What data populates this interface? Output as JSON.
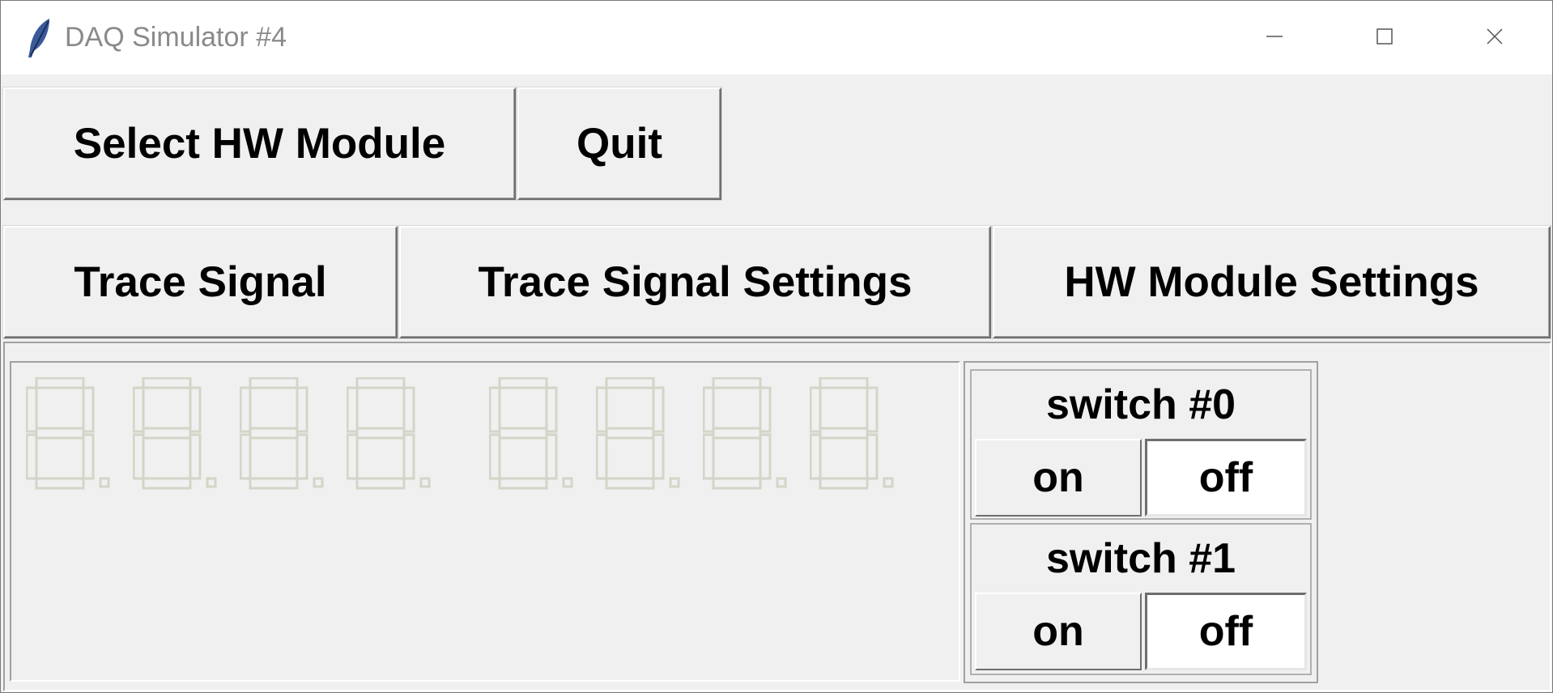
{
  "window": {
    "title": "DAQ Simulator #4",
    "icon": "feather-icon",
    "controls": [
      "minimize-icon",
      "maximize-icon",
      "close-icon"
    ]
  },
  "toolbar1": {
    "select_hw_module": "Select HW Module",
    "quit": "Quit"
  },
  "toolbar2": {
    "trace_signal": "Trace Signal",
    "trace_signal_settings": "Trace Signal Settings",
    "hw_module_settings": "HW Module Settings"
  },
  "display": {
    "digit_count": 8,
    "group_size": 4,
    "segment_color": "#d4d4c8",
    "lit_segments": []
  },
  "switches": [
    {
      "label": "switch #0",
      "on_label": "on",
      "off_label": "off",
      "state": "off"
    },
    {
      "label": "switch #1",
      "on_label": "on",
      "off_label": "off",
      "state": "off"
    }
  ]
}
